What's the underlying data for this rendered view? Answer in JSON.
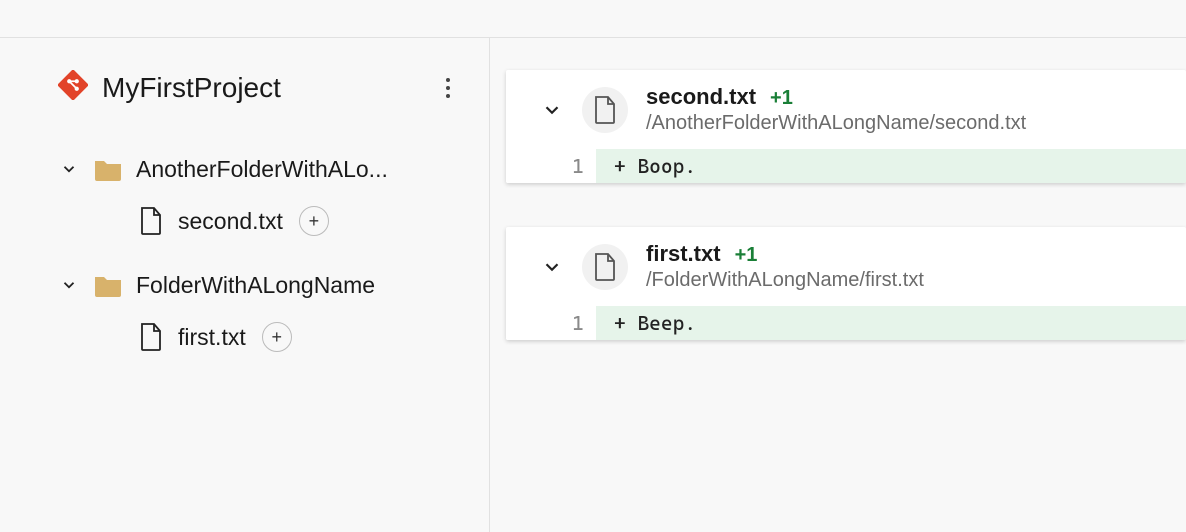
{
  "project": {
    "name": "MyFirstProject"
  },
  "tree": {
    "folders": [
      {
        "name": "AnotherFolderWithALo...",
        "files": [
          {
            "name": "second.txt",
            "added": true
          }
        ]
      },
      {
        "name": "FolderWithALongName",
        "files": [
          {
            "name": "first.txt",
            "added": true
          }
        ]
      }
    ]
  },
  "diffs": [
    {
      "filename": "second.txt",
      "delta": "+1",
      "path": "/AnotherFolderWithALongName/second.txt",
      "line_no": "1",
      "line_text": "+ Boop."
    },
    {
      "filename": "first.txt",
      "delta": "+1",
      "path": "/FolderWithALongName/first.txt",
      "line_no": "1",
      "line_text": "+ Beep."
    }
  ]
}
